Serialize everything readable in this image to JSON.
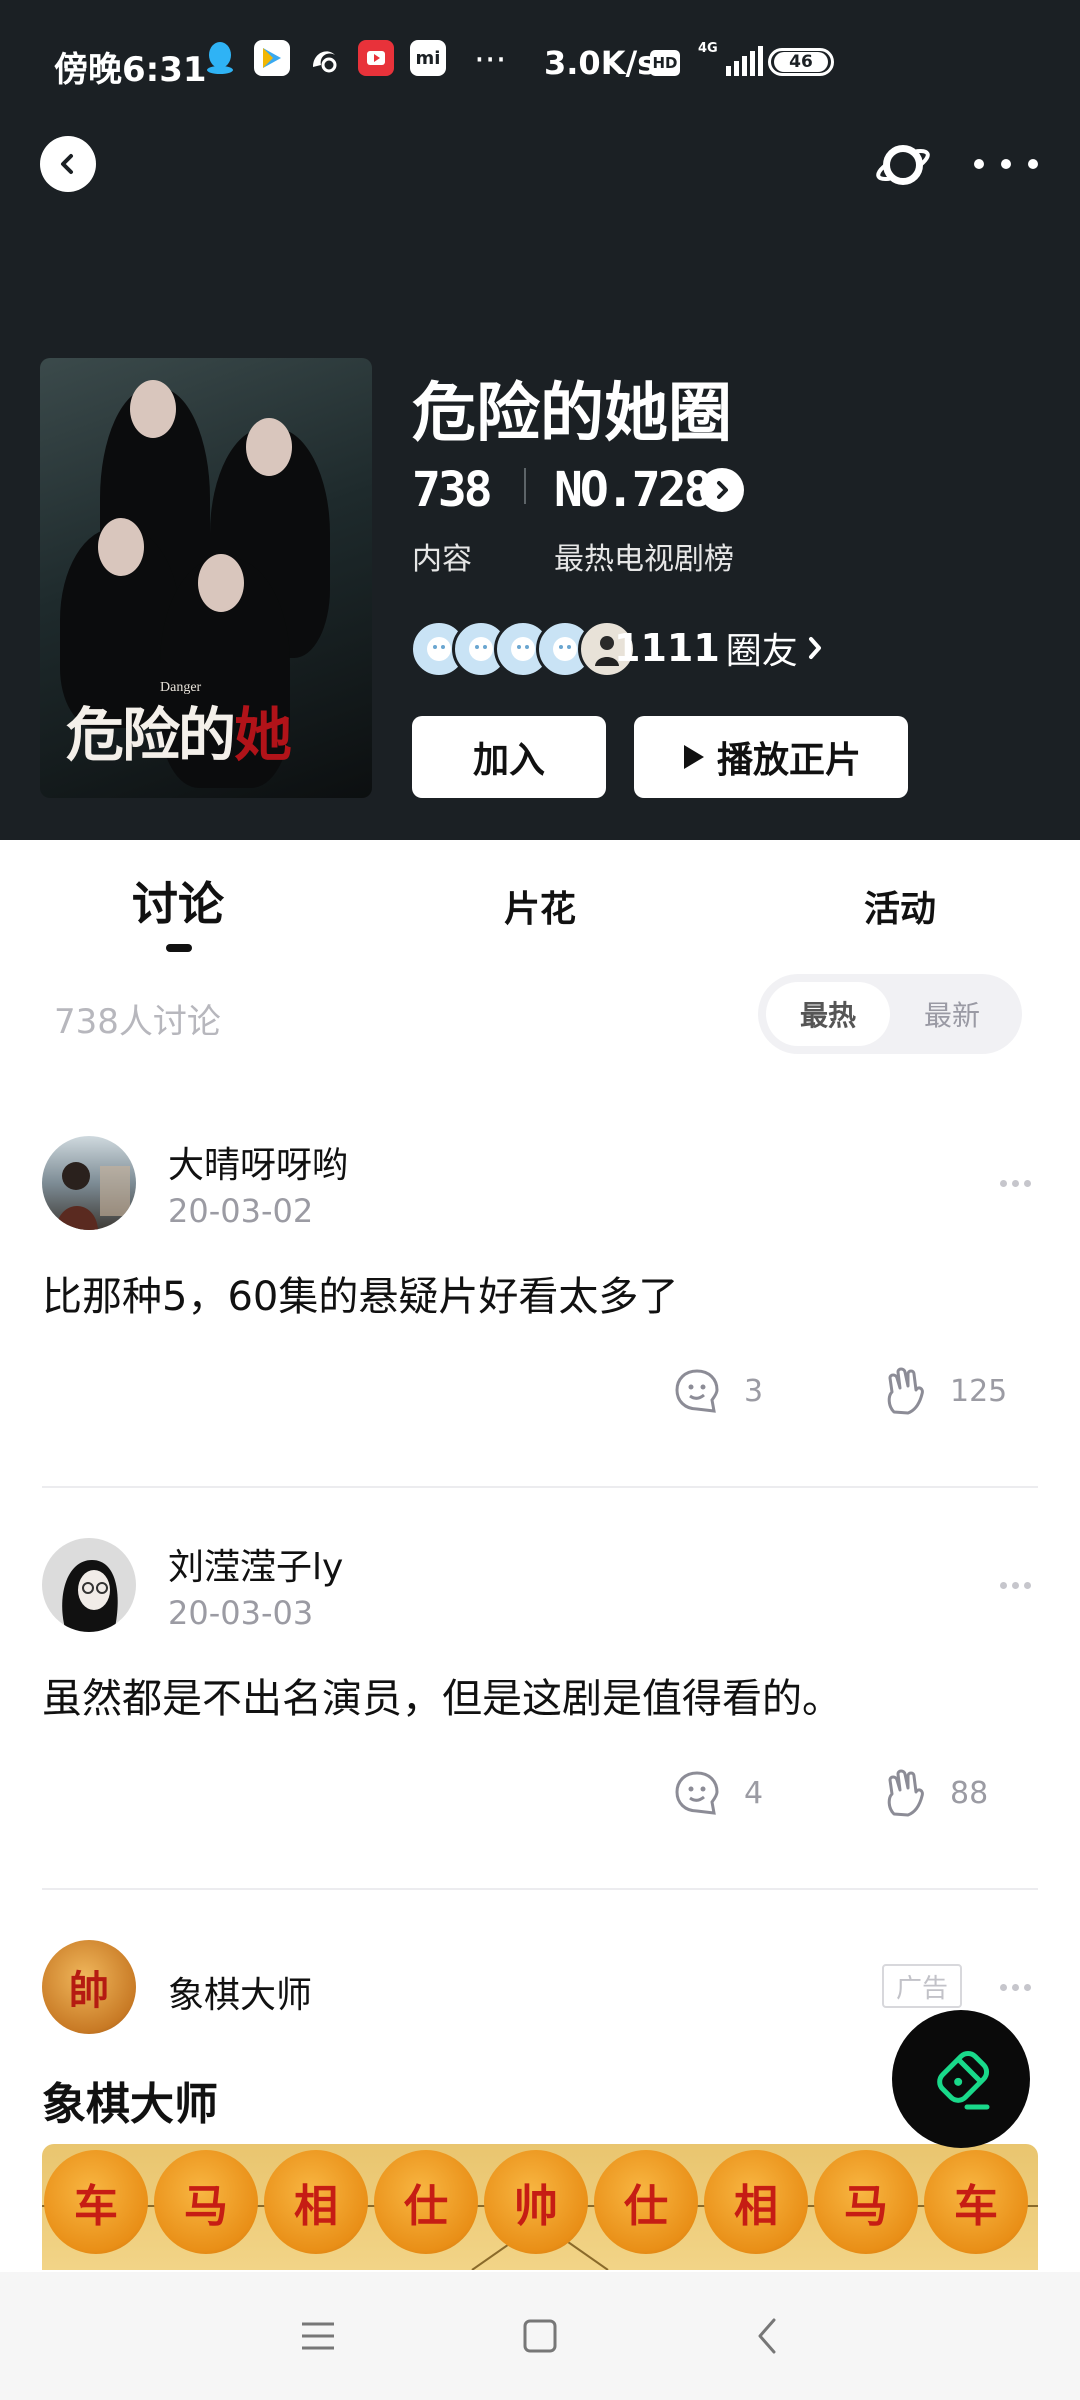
{
  "status_bar": {
    "time": "傍晚6:31",
    "net_speed": "3.0K/s",
    "hd": "HD",
    "network": "4G",
    "battery": "46",
    "overflow": "···"
  },
  "circle": {
    "name": "危险的她圈",
    "poster_title_a": "危险的",
    "poster_title_b": "她",
    "poster_subtitle": "Danger",
    "content_count": "738",
    "content_label": "内容",
    "rank": "NO.728",
    "rank_label": "最热电视剧榜",
    "members_count": "1111",
    "members_unit": "圈友",
    "join_label": "加入",
    "play_label": "播放正片"
  },
  "tabs": [
    {
      "label": "讨论",
      "active": true
    },
    {
      "label": "片花",
      "active": false
    },
    {
      "label": "活动",
      "active": false
    }
  ],
  "discussion": {
    "count_text": "738人讨论",
    "sort_hot": "最热",
    "sort_new": "最新"
  },
  "posts": [
    {
      "user": "大晴呀呀哟",
      "date": "20-03-02",
      "text": "比那种5，60集的悬疑片好看太多了",
      "comments": "3",
      "likes": "125"
    },
    {
      "user": "刘滢滢子ly",
      "date": "20-03-03",
      "text": "虽然都是不出名演员，但是这剧是值得看的。",
      "comments": "4",
      "likes": "88"
    }
  ],
  "ad": {
    "advertiser": "象棋大师",
    "avatar_char": "帥",
    "tag": "广告",
    "title": "象棋大师",
    "pieces": [
      "车",
      "马",
      "相",
      "仕",
      "帅",
      "仕",
      "相",
      "马",
      "车"
    ]
  },
  "colors": {
    "header_bg": "#1b2024",
    "accent_fab": "#19d98a",
    "chess_red": "#c61d14"
  },
  "icons": [
    "back-icon",
    "planet-icon",
    "more-icon",
    "chevron-right-icon",
    "comment-icon",
    "like-hand-icon",
    "edit-pen-icon",
    "menu-icon",
    "home-square-icon",
    "back-triangle-icon"
  ]
}
